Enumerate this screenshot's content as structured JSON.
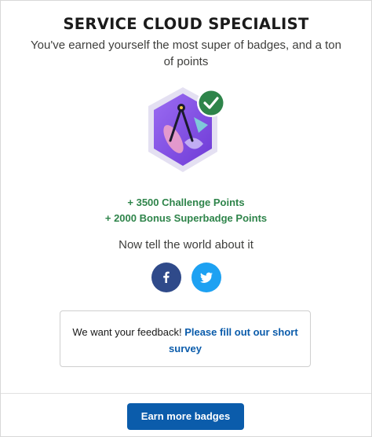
{
  "modal": {
    "title": "SERVICE CLOUD SPECIALIST",
    "subtitle": "You've earned yourself the most super of badges, and a ton of points"
  },
  "badge": {
    "icon": "superbadge-compass-icon",
    "check_icon": "checkmark-icon",
    "colors": {
      "hex_fill": "#8b5cf6",
      "hex_border": "#e4e0f2",
      "check_bg": "#2e844a"
    }
  },
  "points": {
    "challenge": "+ 3500 Challenge Points",
    "bonus": "+ 2000 Bonus Superbadge Points",
    "color": "#2e844a"
  },
  "share": {
    "prompt": "Now tell the world about it",
    "facebook_icon": "facebook-icon",
    "twitter_icon": "twitter-icon"
  },
  "feedback": {
    "text": "We want your feedback!",
    "link_text": "Please fill out our short survey"
  },
  "footer": {
    "button_label": "Earn more badges",
    "button_color": "#0b5cab"
  }
}
